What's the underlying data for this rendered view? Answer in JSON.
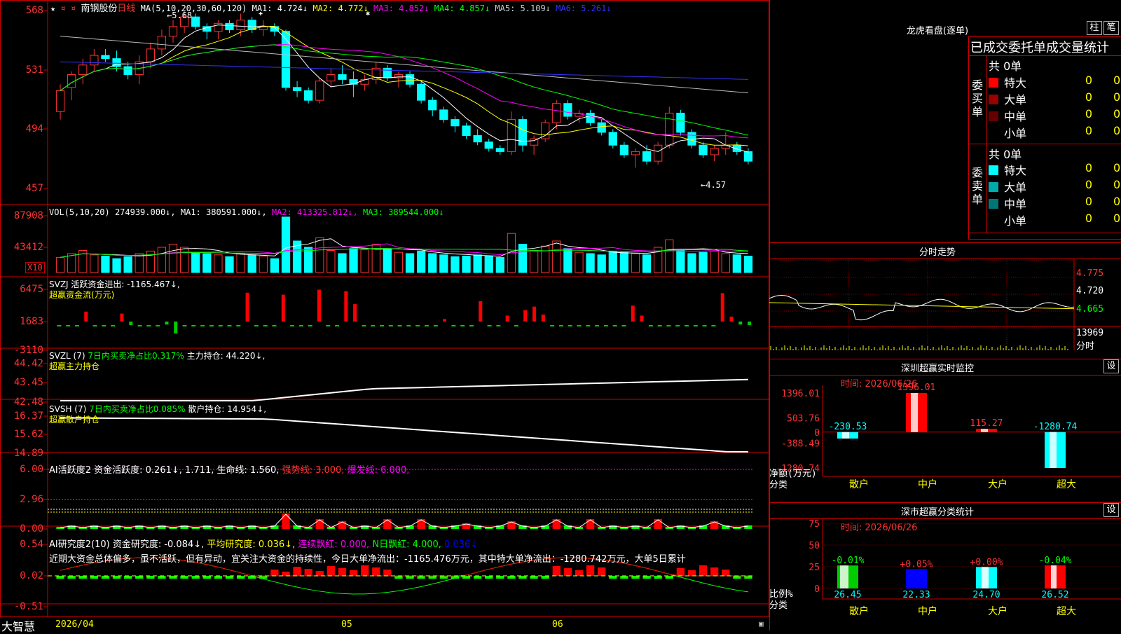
{
  "stock": {
    "name": "南钢股份",
    "period": "日线"
  },
  "price_panel": {
    "axis": [
      "568",
      "531",
      "494",
      "457"
    ],
    "ma_params": "MA(5,10,20,30,60,120)",
    "ma": [
      {
        "label": "MA1: 4.724↓",
        "color": "#ffffff"
      },
      {
        "label": "MA2: 4.772↓",
        "color": "#ffff00"
      },
      {
        "label": "MA3: 4.852↓",
        "color": "#ff00ff"
      },
      {
        "label": "MA4: 4.857↓",
        "color": "#00ff00"
      },
      {
        "label": "MA5: 5.109↓",
        "color": "#cccccc"
      },
      {
        "label": "MA6: 5.261↓",
        "color": "#3333ff"
      }
    ],
    "high_label": "5.68",
    "low_label": "←4.57",
    "star_marker": "★",
    "ylim": [
      4.5,
      5.7
    ]
  },
  "vol_panel": {
    "axis": [
      "87908",
      "43412"
    ],
    "unit": "X10",
    "params": "VOL(5,10,20)",
    "current": "274939.000↓,",
    "ma": [
      {
        "label": "MA1: 380591.000↓,",
        "color": "#ffffff"
      },
      {
        "label": "MA2: 413325.812↓,",
        "color": "#ff00ff"
      },
      {
        "label": "MA3: 389544.000↓",
        "color": "#00ff00"
      }
    ]
  },
  "svzj_panel": {
    "axis": [
      "6475",
      "1683",
      "-3110"
    ],
    "name": "SVZJ",
    "label1": "活跃资金进出: -1165.467↓,",
    "label2": "超赢资金流(万元)"
  },
  "svzl_panel": {
    "axis": [
      "44.42",
      "43.45",
      "42.48"
    ],
    "name": "SVZL (7)",
    "label1": "7日内买卖净占比0.317%",
    "label2": "主力持仓: 44.220↓,",
    "label3": "超赢主力持仓"
  },
  "svsh_panel": {
    "axis": [
      "16.37",
      "15.62",
      "14.89"
    ],
    "name": "SVSH (7)",
    "label1": "7日内买卖净占比0.085%",
    "label2": "散户持仓: 14.954↓,",
    "label3": "超赢散户持仓"
  },
  "ai_active_panel": {
    "axis": [
      "6.00",
      "2.96",
      "0.00"
    ],
    "name": "AI活跃度2",
    "label1": "资金活跃度: 0.261↓,",
    "label2": "1.711,",
    "label3": "生命线: 1.560,",
    "label4": "强势线: 3.000,",
    "label5": "爆发线: 6.000,"
  },
  "ai_research_panel": {
    "axis": [
      "0.54",
      "0.02",
      "-0.51"
    ],
    "name": "AI研究度2(10)",
    "label1": "资金研究度: -0.084↓,",
    "label2": "平均研究度: 0.036↓,",
    "label3": "连续飘红: 0.000,",
    "label4": "N日飘红: 4.000,",
    "label5": "0.036↓",
    "comment": "近期大资金总体偏多，虽不活跃，但有异动，宜关注大资金的持续性，今日大单净流出：-1165.476万元，其中特大单净流出：-1280.742万元，大单5日累计"
  },
  "bottom_bar": {
    "brand": "大智慧",
    "date": "2026/04",
    "m5": "05",
    "m6": "06"
  },
  "dragon_tiger": {
    "title": "龙虎看盘(逐单)",
    "btn_column": "柱",
    "btn_order": "笔",
    "subtitle": "已成交委托单成交量统计",
    "buy": {
      "side": [
        "委",
        "买",
        "单"
      ],
      "total": "共 0单",
      "rows": [
        {
          "name": "特大",
          "count": "0",
          "pct": "0%",
          "color": "#ff0000"
        },
        {
          "name": "大单",
          "count": "0",
          "pct": "0%",
          "color": "#990000"
        },
        {
          "name": "中单",
          "count": "0",
          "pct": "0%",
          "color": "#660000"
        },
        {
          "name": "小单",
          "count": "0",
          "pct": "0%",
          "color": "#000000"
        }
      ]
    },
    "sell": {
      "side": [
        "委",
        "卖",
        "单"
      ],
      "total": "共 0单",
      "rows": [
        {
          "name": "特大",
          "count": "0",
          "pct": "0%",
          "color": "#00ffff"
        },
        {
          "name": "大单",
          "count": "0",
          "pct": "0%",
          "color": "#00aaaa"
        },
        {
          "name": "中单",
          "count": "0",
          "pct": "0%",
          "color": "#007777"
        },
        {
          "name": "小单",
          "count": "0",
          "pct": "0%",
          "color": "#000000"
        }
      ]
    }
  },
  "intraday": {
    "title": "分时走势",
    "axis": [
      "4.775",
      "4.720",
      "4.665"
    ],
    "vol_axis": [
      "13969",
      "分时"
    ]
  },
  "sz_monitor": {
    "title": "深圳超赢实时监控",
    "set": "设",
    "time": "时间: 2026/06/26",
    "axis": [
      "1396.01",
      "503.76",
      "0",
      "-388.49",
      "-1280.74"
    ],
    "ylabel1": "净额(万元)",
    "ylabel2": "分类",
    "categories": [
      "散户",
      "中户",
      "大户",
      "超大"
    ],
    "values": [
      -230.53,
      1396.01,
      115.27,
      -1280.74
    ],
    "value_labels": [
      "-230.53",
      "1396.01",
      "115.27",
      "-1280.74"
    ]
  },
  "sz_class": {
    "title": "深市超赢分类统计",
    "set": "设",
    "time": "时间: 2026/06/26",
    "axis": [
      "75",
      "50",
      "25",
      "0"
    ],
    "ylabel1": "比例%",
    "ylabel2": "分类",
    "categories": [
      "散户",
      "中户",
      "大户",
      "超大"
    ],
    "values": [
      26.45,
      22.33,
      24.7,
      26.52
    ],
    "value_labels": [
      "26.45",
      "22.33",
      "24.70",
      "26.52"
    ],
    "change_labels": [
      "-0.01%",
      "+0.05%",
      "+0.00%",
      "-0.04%"
    ],
    "colors": [
      "#00cc00",
      "#0000ff",
      "#00ffff",
      "#ff0000"
    ]
  },
  "chart_data": {
    "type": "candlestick",
    "title": "南钢股份 日线",
    "ylim": [
      4.5,
      5.7
    ],
    "ohlc": [
      [
        5.05,
        5.22,
        5.0,
        5.18
      ],
      [
        5.2,
        5.3,
        5.12,
        5.28
      ],
      [
        5.28,
        5.38,
        5.22,
        5.34
      ],
      [
        5.34,
        5.44,
        5.3,
        5.4
      ],
      [
        5.4,
        5.44,
        5.36,
        5.38
      ],
      [
        5.38,
        5.43,
        5.3,
        5.33
      ],
      [
        5.33,
        5.36,
        5.25,
        5.28
      ],
      [
        5.28,
        5.4,
        5.22,
        5.36
      ],
      [
        5.36,
        5.48,
        5.32,
        5.44
      ],
      [
        5.44,
        5.56,
        5.4,
        5.52
      ],
      [
        5.52,
        5.62,
        5.48,
        5.58
      ],
      [
        5.58,
        5.68,
        5.54,
        5.64
      ],
      [
        5.64,
        5.66,
        5.56,
        5.58
      ],
      [
        5.58,
        5.6,
        5.5,
        5.55
      ],
      [
        5.55,
        5.62,
        5.5,
        5.6
      ],
      [
        5.6,
        5.62,
        5.54,
        5.56
      ],
      [
        5.56,
        5.66,
        5.52,
        5.62
      ],
      [
        5.62,
        5.64,
        5.54,
        5.56
      ],
      [
        5.56,
        5.62,
        5.52,
        5.58
      ],
      [
        5.58,
        5.6,
        5.52,
        5.55
      ],
      [
        5.55,
        5.56,
        5.18,
        5.2
      ],
      [
        5.2,
        5.24,
        5.14,
        5.18
      ],
      [
        5.18,
        5.2,
        5.1,
        5.12
      ],
      [
        5.12,
        5.26,
        5.1,
        5.24
      ],
      [
        5.24,
        5.32,
        5.2,
        5.28
      ],
      [
        5.28,
        5.34,
        5.22,
        5.25
      ],
      [
        5.25,
        5.3,
        5.14,
        5.22
      ],
      [
        5.22,
        5.28,
        5.18,
        5.25
      ],
      [
        5.25,
        5.36,
        5.22,
        5.32
      ],
      [
        5.32,
        5.34,
        5.24,
        5.26
      ],
      [
        5.26,
        5.3,
        5.2,
        5.28
      ],
      [
        5.28,
        5.3,
        5.2,
        5.22
      ],
      [
        5.22,
        5.24,
        5.1,
        5.12
      ],
      [
        5.12,
        5.14,
        5.02,
        5.06
      ],
      [
        5.06,
        5.08,
        4.98,
        5.0
      ],
      [
        5.0,
        5.02,
        4.92,
        4.96
      ],
      [
        4.96,
        4.98,
        4.88,
        4.9
      ],
      [
        4.9,
        4.94,
        4.84,
        4.86
      ],
      [
        4.86,
        4.88,
        4.8,
        4.82
      ],
      [
        4.82,
        4.84,
        4.78,
        4.8
      ],
      [
        4.8,
        5.05,
        4.78,
        5.0
      ],
      [
        5.0,
        5.02,
        4.8,
        4.84
      ],
      [
        4.84,
        4.9,
        4.78,
        4.88
      ],
      [
        4.88,
        5.0,
        4.86,
        4.98
      ],
      [
        4.98,
        5.12,
        4.94,
        5.1
      ],
      [
        5.1,
        5.12,
        5.0,
        5.02
      ],
      [
        5.02,
        5.06,
        4.98,
        5.04
      ],
      [
        5.04,
        5.06,
        4.96,
        4.98
      ],
      [
        4.98,
        5.0,
        4.9,
        4.92
      ],
      [
        4.92,
        4.94,
        4.82,
        4.84
      ],
      [
        4.84,
        4.86,
        4.76,
        4.78
      ],
      [
        4.78,
        4.82,
        4.7,
        4.8
      ],
      [
        4.8,
        4.84,
        4.72,
        4.74
      ],
      [
        4.74,
        4.86,
        4.72,
        4.84
      ],
      [
        4.84,
        5.08,
        4.82,
        5.04
      ],
      [
        5.04,
        5.06,
        4.9,
        4.92
      ],
      [
        4.92,
        4.94,
        4.82,
        4.84
      ],
      [
        4.84,
        4.86,
        4.76,
        4.78
      ],
      [
        4.78,
        4.84,
        4.74,
        4.82
      ],
      [
        4.82,
        4.92,
        4.78,
        4.84
      ],
      [
        4.84,
        4.86,
        4.78,
        4.8
      ],
      [
        4.8,
        4.82,
        4.72,
        4.74
      ]
    ],
    "volume": [
      24,
      30,
      35,
      28,
      26,
      22,
      25,
      30,
      34,
      40,
      45,
      40,
      32,
      30,
      28,
      25,
      30,
      28,
      26,
      22,
      88,
      50,
      40,
      55,
      35,
      30,
      38,
      36,
      45,
      38,
      32,
      30,
      34,
      30,
      28,
      25,
      26,
      28,
      26,
      24,
      62,
      45,
      35,
      42,
      50,
      38,
      32,
      30,
      28,
      34,
      32,
      30,
      28,
      40,
      52,
      35,
      30,
      32,
      34,
      30,
      28,
      26
    ],
    "svzj": [
      -300,
      -300,
      -300,
      2000,
      -300,
      -300,
      -200,
      1600,
      -700,
      -300,
      -300,
      -300,
      -600,
      -2400,
      -300,
      -300,
      -300,
      -400,
      -400,
      -300,
      -300,
      5800,
      -300,
      -300,
      -300,
      5400,
      -300,
      -300,
      -300,
      6400,
      -300,
      -300,
      6100,
      3500,
      -300,
      -300,
      -300,
      -300,
      -300,
      -300,
      -300,
      -400,
      -300,
      500,
      -300,
      -300,
      -300,
      4100,
      -300,
      -300,
      1200,
      -300,
      2300,
      3000,
      1400,
      -300,
      -300,
      -300,
      -400,
      -300,
      -300,
      -300,
      -300,
      -300,
      3200,
      1200,
      -300,
      -300,
      -300,
      -300,
      -300,
      -300,
      -200,
      -300,
      5700,
      1000,
      -600,
      -700
    ],
    "sz_net": {
      "categories": [
        "散户",
        "中户",
        "大户",
        "超大"
      ],
      "values": [
        -230.53,
        1396.01,
        115.27,
        -1280.74
      ]
    },
    "sz_ratio": {
      "categories": [
        "散户",
        "中户",
        "大户",
        "超大"
      ],
      "values": [
        26.45,
        22.33,
        24.7,
        26.52
      ]
    }
  }
}
